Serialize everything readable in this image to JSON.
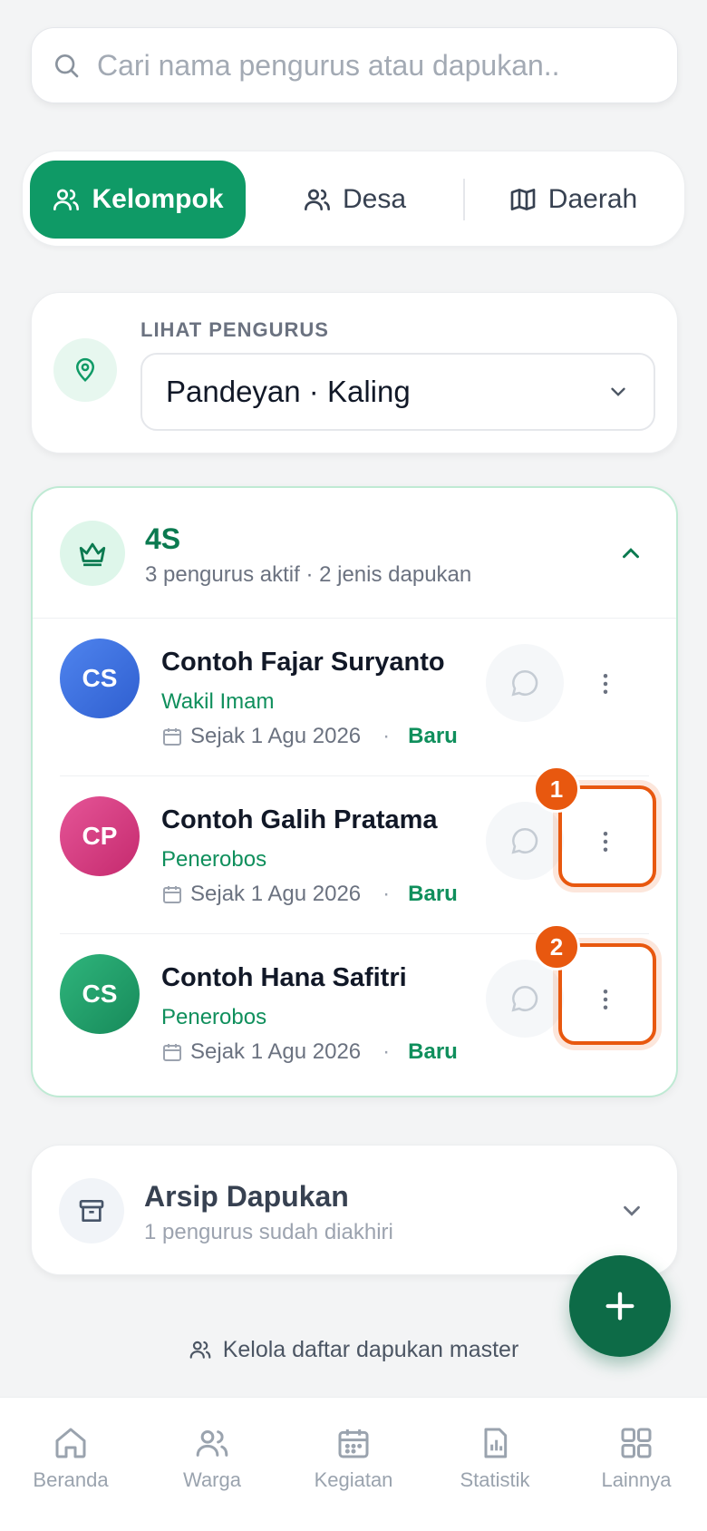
{
  "search": {
    "placeholder": "Cari nama pengurus atau dapukan.."
  },
  "tabs": [
    {
      "label": "Kelompok",
      "active": true
    },
    {
      "label": "Desa",
      "active": false
    },
    {
      "label": "Daerah",
      "active": false
    }
  ],
  "location": {
    "label": "LIHAT PENGURUS",
    "selected": "Pandeyan · Kaling"
  },
  "group": {
    "title": "4S",
    "subtitle": "3 pengurus aktif · 2 jenis dapukan",
    "members": [
      {
        "initials": "CS",
        "name": "Contoh Fajar Suryanto",
        "role": "Wakil Imam",
        "since": "Sejak 1 Agu 2026",
        "badge": "Baru",
        "color": "#3b6fe0"
      },
      {
        "initials": "CP",
        "name": "Contoh Galih Pratama",
        "role": "Penerobos",
        "since": "Sejak 1 Agu 2026",
        "badge": "Baru",
        "color": "#d6397f",
        "marker": "1"
      },
      {
        "initials": "CS",
        "name": "Contoh Hana Safitri",
        "role": "Penerobos",
        "since": "Sejak 1 Agu 2026",
        "badge": "Baru",
        "color": "#1f9d69",
        "marker": "2"
      }
    ]
  },
  "archive": {
    "title": "Arsip Dapukan",
    "subtitle": "1 pengurus sudah diakhiri"
  },
  "manage_link": "Kelola daftar dapukan master",
  "nav": [
    {
      "label": "Beranda",
      "icon": "home-icon"
    },
    {
      "label": "Warga",
      "icon": "users-icon"
    },
    {
      "label": "Kegiatan",
      "icon": "calendar-icon"
    },
    {
      "label": "Statistik",
      "icon": "chart-file-icon"
    },
    {
      "label": "Lainnya",
      "icon": "grid-icon"
    }
  ],
  "colors": {
    "primary": "#0f9a66",
    "primary_dark": "#0d6b47",
    "highlight": "#e8580f"
  }
}
